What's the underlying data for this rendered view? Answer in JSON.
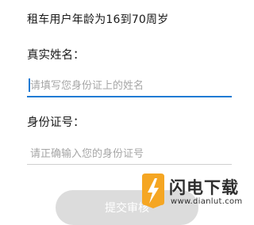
{
  "notice": "租车用户年龄为16到70周岁",
  "name_field": {
    "label": "真实姓名：",
    "placeholder": "请填写您身份证上的姓名",
    "value": ""
  },
  "id_field": {
    "label": "身份证号：",
    "placeholder": "请正确输入您的身份证号",
    "value": ""
  },
  "submit_label": "提交审核",
  "watermark": {
    "title": "闪电下载",
    "url": "www.dianlut.com",
    "icon": "lightning-bolt-icon",
    "colors": {
      "accent": "#f5a623",
      "text": "#2e2e2e"
    }
  },
  "colors": {
    "focus": "#1f7bd4",
    "placeholder": "#a6a6a6",
    "button_disabled": "#dcdcdc"
  }
}
